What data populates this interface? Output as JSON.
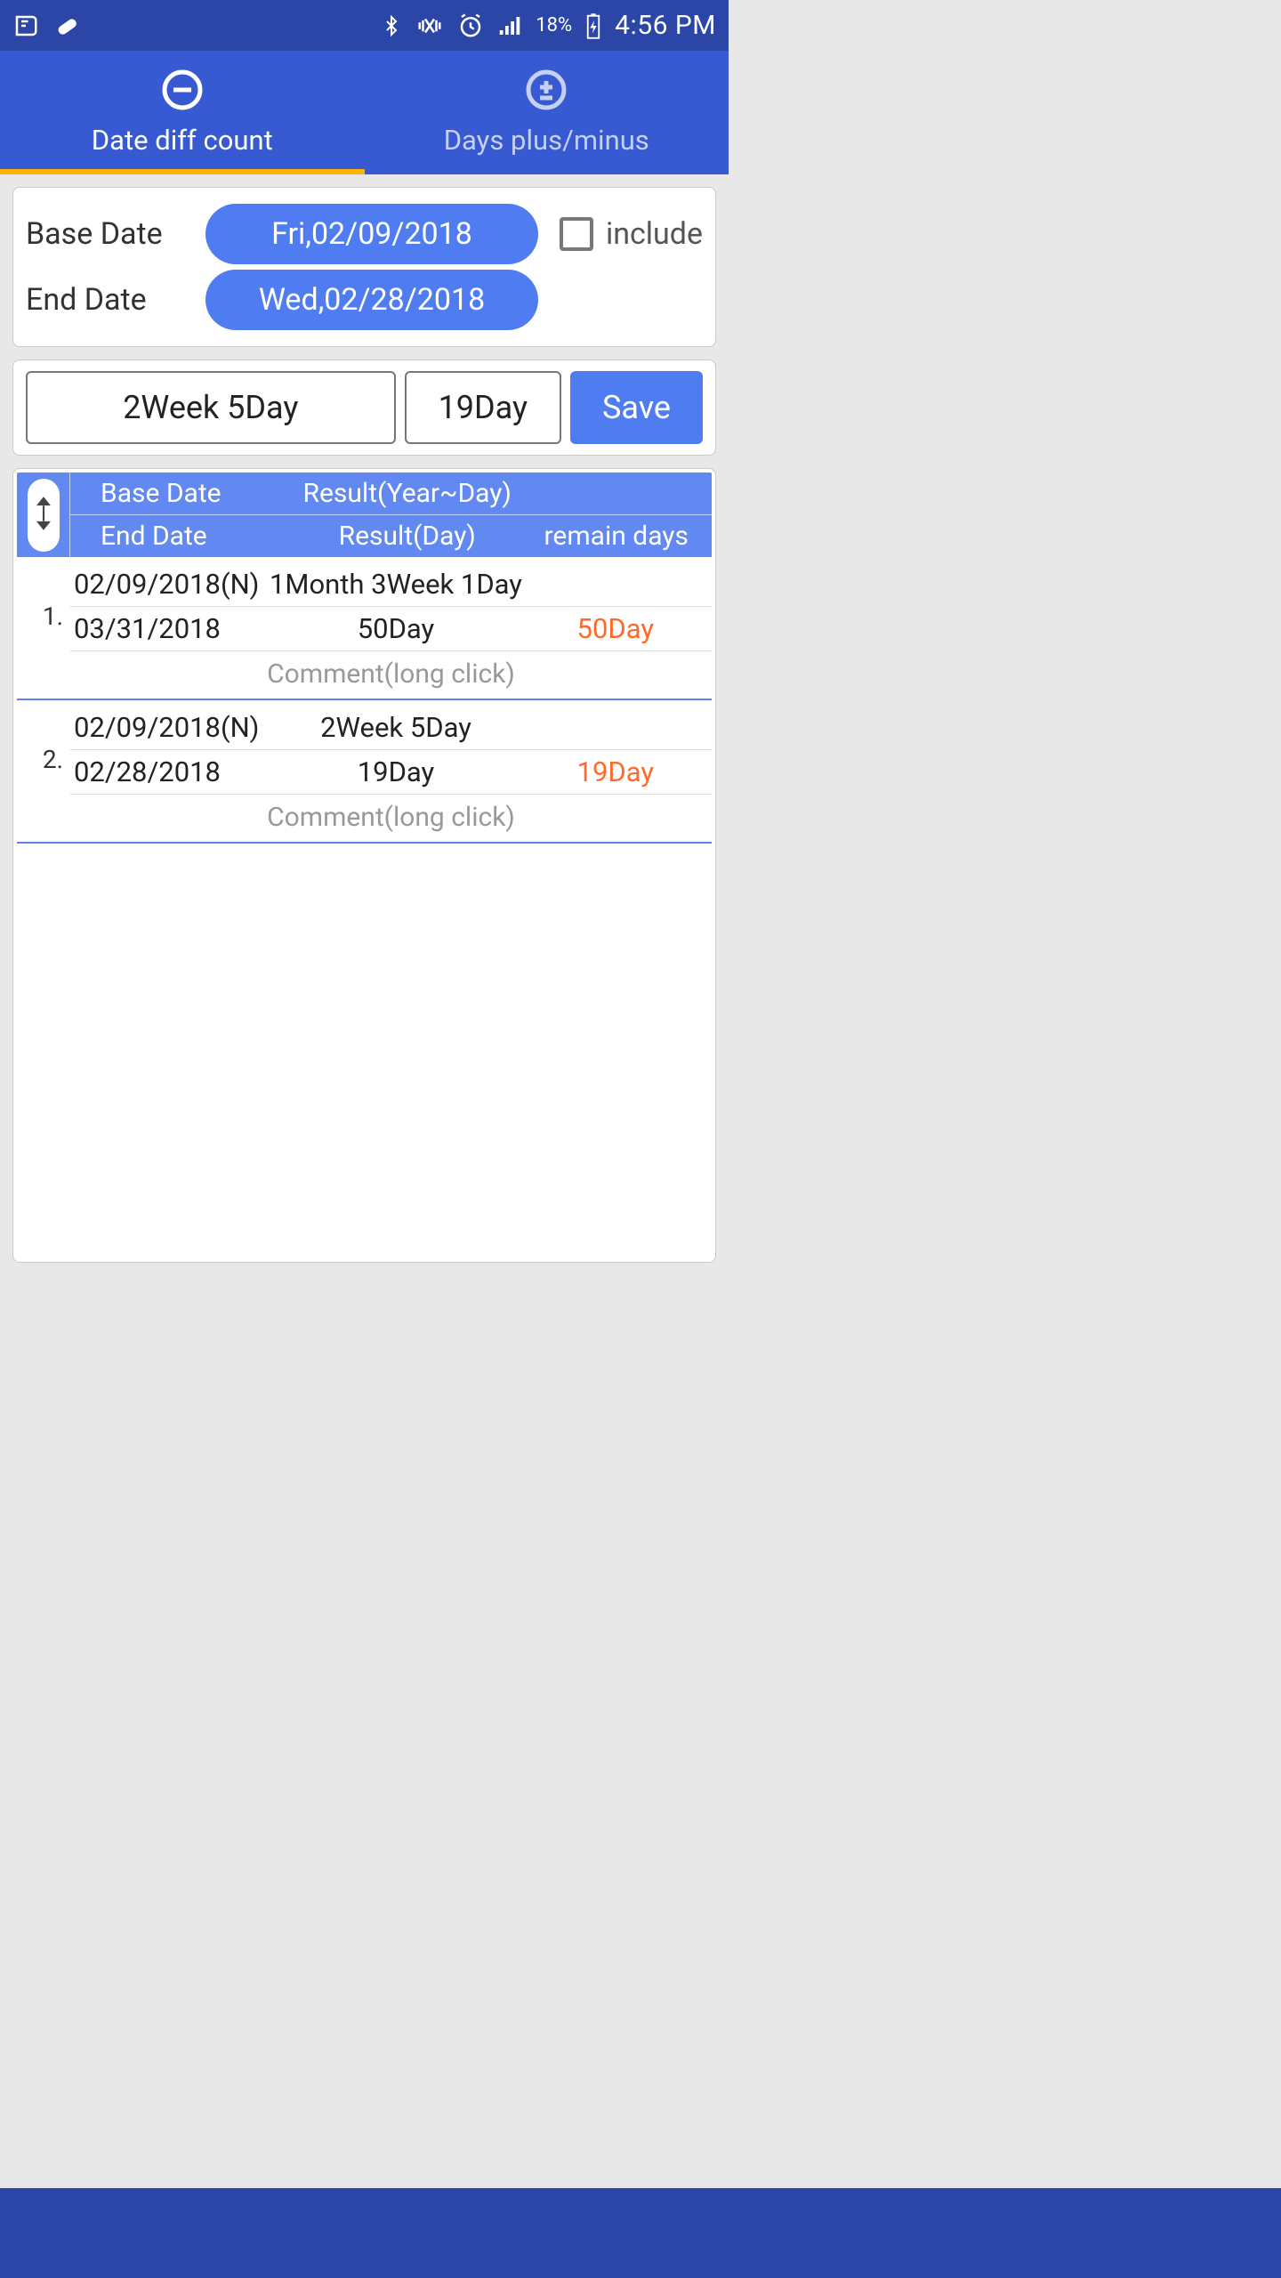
{
  "status": {
    "battery_pct": "18%",
    "time": "4:56 PM"
  },
  "tabs": {
    "diff": "Date diff count",
    "plusminus": "Days plus/minus"
  },
  "dates": {
    "base_label": "Base Date",
    "base_value": "Fri,02/09/2018",
    "end_label": "End Date",
    "end_value": "Wed,02/28/2018",
    "include_label": "include"
  },
  "result": {
    "long": "2Week 5Day",
    "days": "19Day",
    "save": "Save"
  },
  "table": {
    "headers": {
      "r1c1": "Base Date",
      "r1c2": "Result(Year~Day)",
      "r2c1": "End Date",
      "r2c2": "Result(Day)",
      "r2c3": "remain days"
    },
    "comment_hint": "Comment(long click)",
    "rows": [
      {
        "num": "1.",
        "base": "02/09/2018(N)",
        "long": "1Month 3Week 1Day",
        "end": "03/31/2018",
        "days": "50Day",
        "remain": "50Day"
      },
      {
        "num": "2.",
        "base": "02/09/2018(N)",
        "long": "2Week 5Day",
        "end": "02/28/2018",
        "days": "19Day",
        "remain": "19Day"
      }
    ]
  }
}
